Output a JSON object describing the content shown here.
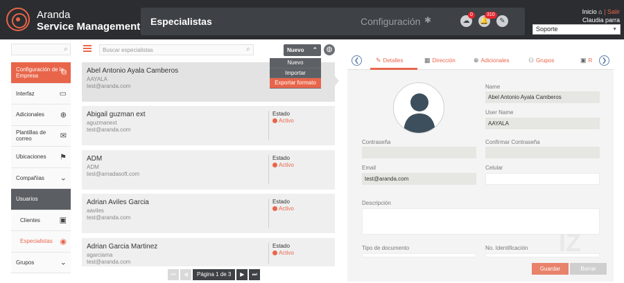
{
  "header": {
    "brand_line1": "Aranda",
    "brand_line2": "Service Management",
    "page_title": "Especialistas",
    "config_label": "Configuración",
    "cloud_badge": "0",
    "bell_badge": "310",
    "inicio": "Inicio",
    "separator": "|",
    "salir": "Salir",
    "user_name": "Claudia parra",
    "role_select": "Soporte",
    "accent": "#e8654a"
  },
  "sidebar": {
    "search_placeholder": "",
    "items": [
      {
        "label": "Configuración de la Empresa",
        "icon": "copy-icon"
      },
      {
        "label": "Interfaz",
        "icon": "monitor-icon"
      },
      {
        "label": "Adicionales",
        "icon": "plus-circle-icon"
      },
      {
        "label": "Plantillas de correo",
        "icon": "envelope-icon"
      },
      {
        "label": "Ubicaciones",
        "icon": "signpost-icon"
      },
      {
        "label": "Compañías",
        "icon": "chevron-down-icon"
      },
      {
        "label": "Usuarios",
        "icon": ""
      },
      {
        "label": "Clientes",
        "icon": "contact-card-icon"
      },
      {
        "label": "Especialistas",
        "icon": "specialist-icon"
      },
      {
        "label": "Grupos",
        "icon": "chevron-down-icon"
      }
    ]
  },
  "list": {
    "search_placeholder": "Buscar especialistas",
    "new_button": "Nuevo",
    "dropdown": [
      "Nuevo",
      "Importar",
      "Exportar formato"
    ],
    "status_label": "Estado",
    "rows": [
      {
        "name": "Abel Antonio Ayala Camberos",
        "login": "AAYALA",
        "email": "test@aranda.com",
        "status": ""
      },
      {
        "name": "Abigail guzman ext",
        "login": "aguzmanext",
        "email": "test@aranda.com",
        "status": "Activo"
      },
      {
        "name": "ADM",
        "login": "ADM",
        "email": "test@arnadasoft.com",
        "status": "Activo"
      },
      {
        "name": "Adrian Aviles Garcia",
        "login": "aaviles",
        "email": "test@aranda.com",
        "status": "Activo"
      },
      {
        "name": "Adrian Garcia Martinez",
        "login": "agarciama",
        "email": "test@aranda.com",
        "status": "Activo"
      }
    ],
    "pager_label": "Página 1 de 3"
  },
  "detail": {
    "tabs": [
      "Detalles",
      "Dirección",
      "Adicionales",
      "Grupos",
      "R"
    ],
    "fields": {
      "name_label": "Name",
      "name_value": "Abel Antonio Ayala Camberos",
      "username_label": "User Name",
      "username_value": "AAYALA",
      "password_label": "Contraseña",
      "confirm_label": "Confirmar Contraseña",
      "email_label": "Email",
      "email_value": "test@aranda.com",
      "cel_label": "Celular",
      "desc_label": "Descripción",
      "doc_label": "Tipo de documento",
      "id_label": "No. Identificación"
    },
    "save_button": "Guardar",
    "delete_button": "Borrar"
  }
}
